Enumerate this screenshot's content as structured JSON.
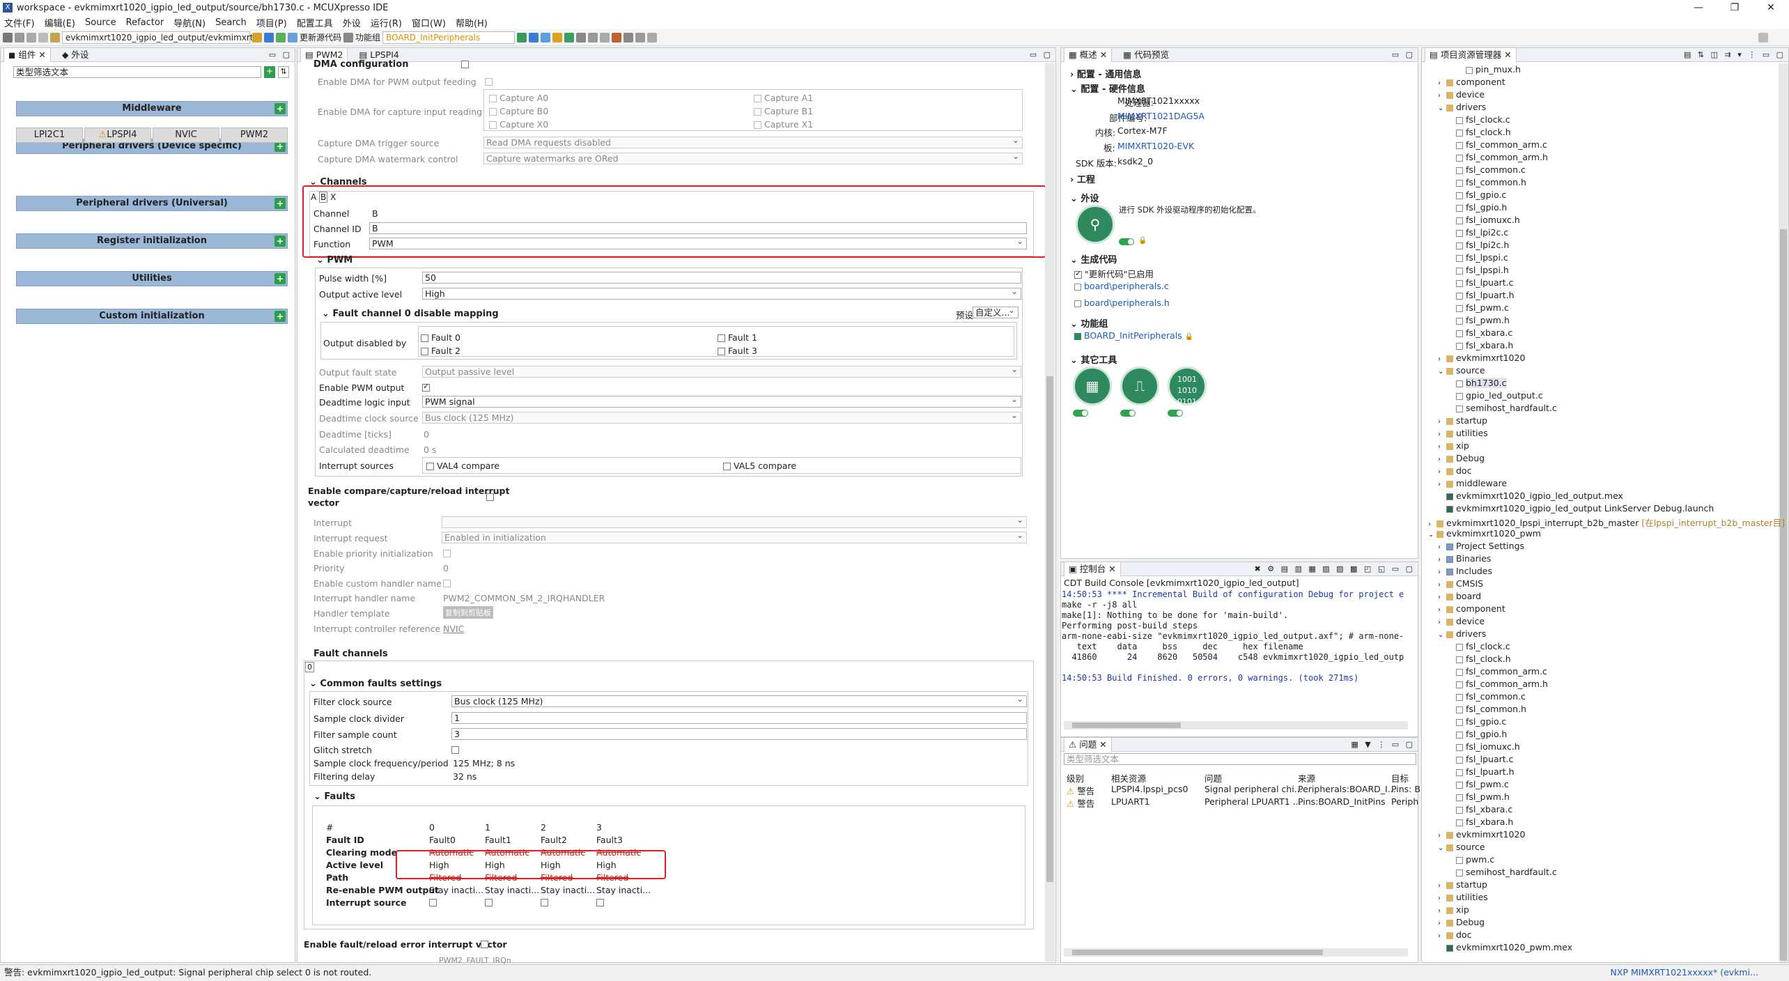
{
  "window": {
    "title": "workspace - evkmimxrt1020_igpio_led_output/source/bh1730.c - MCUXpresso IDE",
    "controls": [
      "—",
      "❐",
      "✕"
    ]
  },
  "menu": [
    "文件(F)",
    "编辑(E)",
    "Source",
    "Refactor",
    "导航(N)",
    "Search",
    "项目(P)",
    "配置工具",
    "外设",
    "运行(R)",
    "窗口(W)",
    "帮助(H)"
  ],
  "toolbar": {
    "project_combo": "evkmimxrt1020_igpio_led_output/evkmimxrt1(",
    "update_code": "更新源代码",
    "func_group_label": "功能组",
    "func_group_value": "BOARD_InitPeripherals"
  },
  "left_panel": {
    "tabs": [
      "组件",
      "外设"
    ],
    "filter_placeholder": "类型筛选文本",
    "middleware": "Middleware",
    "periph_device": "Peripheral drivers (Device specific)",
    "device_buttons": [
      "LPI2C1",
      "LPSPI4",
      "NVIC",
      "PWM2"
    ],
    "periph_universal": "Peripheral drivers (Universal)",
    "register_init": "Register initialization",
    "utilities": "Utilities",
    "custom_init": "Custom initialization"
  },
  "editor": {
    "tabs": [
      "PWM2",
      "LPSPI4"
    ],
    "dma_config": "DMA configuration",
    "dma_pwm_feeding": "Enable DMA for PWM output feeding",
    "dma_capture_reading": "Enable DMA for capture input reading",
    "captures": [
      "Capture A0",
      "Capture A1",
      "Capture B0",
      "Capture B1",
      "Capture X0",
      "Capture X1"
    ],
    "capture_trigger_label": "Capture DMA trigger source",
    "capture_trigger_value": "Read DMA requests disabled",
    "capture_watermark_label": "Capture DMA watermark control",
    "capture_watermark_value": "Capture watermarks are ORed",
    "channels": "Channels",
    "channel_tabs": [
      "A",
      "B",
      "X"
    ],
    "channel_label": "Channel",
    "channel_value": "B",
    "channel_id_label": "Channel ID",
    "channel_id_value": "B",
    "function_label": "Function",
    "function_value": "PWM",
    "pwm_section": "PWM",
    "pulse_width_label": "Pulse width [%]",
    "pulse_width_value": "50",
    "output_active_label": "Output active level",
    "output_active_value": "High",
    "fault_mapping": "Fault channel 0 disable mapping",
    "preset_label": "预设",
    "preset_value": "自定义...",
    "output_disabled_by": "Output disabled by",
    "faults_list": [
      "Fault 0",
      "Fault 1",
      "Fault 2",
      "Fault 3"
    ],
    "output_fault_state_label": "Output fault state",
    "output_fault_state_value": "Output passive level",
    "enable_pwm_output": "Enable PWM output",
    "deadtime_input_label": "Deadtime logic input",
    "deadtime_input_value": "PWM signal",
    "deadtime_clock_label": "Deadtime clock source",
    "deadtime_clock_value": "Bus clock (125 MHz)",
    "deadtime_ticks_label": "Deadtime [ticks]",
    "deadtime_ticks_value": "0",
    "calc_deadtime_label": "Calculated deadtime",
    "calc_deadtime_value": "0 s",
    "interrupt_sources_label": "Interrupt sources",
    "val4": "VAL4 compare",
    "val5": "VAL5 compare",
    "enable_ccr_line1": "Enable compare/capture/reload interrupt",
    "enable_ccr_line2": "vector",
    "interrupt_label": "Interrupt",
    "interrupt_request_label": "Interrupt request",
    "interrupt_request_value": "Enabled in initialization",
    "enable_priority_label": "Enable priority initialization",
    "priority_label": "Priority",
    "priority_value": "0",
    "enable_custom_handler": "Enable custom handler name",
    "handler_name_label": "Interrupt handler name",
    "handler_name_value": "PWM2_COMMON_SM_2_IRQHANDLER",
    "handler_template_label": "Handler template",
    "handler_template_btn": "复制到剪贴板",
    "irq_controller_label": "Interrupt controller reference",
    "irq_controller_value": "NVIC",
    "fault_channels": "Fault channels",
    "fault_channel_tab": "0",
    "common_faults": "Common faults settings",
    "filter_clock_label": "Filter clock source",
    "filter_clock_value": "Bus clock (125 MHz)",
    "sample_divider_label": "Sample clock divider",
    "sample_divider_value": "1",
    "filter_count_label": "Filter sample count",
    "filter_count_value": "3",
    "glitch_label": "Glitch stretch",
    "sample_freq_label": "Sample clock frequency/period",
    "sample_freq_value": "125 MHz; 8 ns",
    "filtering_delay_label": "Filtering delay",
    "filtering_delay_value": "32 ns",
    "faults_section": "Faults",
    "faults_table": {
      "row_labels": [
        "#",
        "Fault ID",
        "Clearing mode",
        "Active level",
        "Path",
        "Re-enable PWM output",
        "Interrupt source"
      ],
      "columns": [
        {
          "num": "0",
          "id": "Fault0",
          "clearing": "Automatic",
          "active": "High",
          "path": "Filtered",
          "reenable": "Stay inacti..."
        },
        {
          "num": "1",
          "id": "Fault1",
          "clearing": "Automatic",
          "active": "High",
          "path": "Filtered",
          "reenable": "Stay inacti..."
        },
        {
          "num": "2",
          "id": "Fault2",
          "clearing": "Automatic",
          "active": "High",
          "path": "Filtered",
          "reenable": "Stay inacti..."
        },
        {
          "num": "3",
          "id": "Fault3",
          "clearing": "Automatic",
          "active": "High",
          "path": "Filtered",
          "reenable": "Stay inacti..."
        }
      ]
    },
    "fault_reload_label": "Enable fault/reload error interrupt vector",
    "bottom_cut_value": "PWM2_FAULT_IRQn"
  },
  "overview": {
    "tabs": [
      "概述",
      "代码预览"
    ],
    "config_common": "配置 - 通用信息",
    "config_hw": "配置 - 硬件信息",
    "processor_label": "处理器:",
    "processor_value": "MIMXRT1021xxxxx",
    "part_label": "部件编号:",
    "part_value": "MIMXRT1021DAG5A",
    "core_label": "内核:",
    "core_value": "Cortex-M7F",
    "board_label": "板:",
    "board_value": "MIMXRT1020-EVK",
    "sdk_label": "SDK 版本:",
    "sdk_value": "ksdk2_0",
    "project": "工程",
    "peripherals": "外设",
    "peripherals_desc": "进行 SDK 外设驱动程序的初始化配置。",
    "gen_code": "生成代码",
    "update_enabled": "\"更新代码\"已启用",
    "file1": "board\\peripherals.c",
    "file2": "board\\peripherals.h",
    "func_group": "功能组",
    "func_group_item": "BOARD_InitPeripherals",
    "other_tools": "其它工具"
  },
  "console": {
    "tab": "控制台",
    "title": "CDT Build Console [evkmimxrt1020_igpio_led_output]",
    "lines": [
      "14:50:53 **** Incremental Build of configuration Debug for project e",
      "make -r -j8 all",
      "make[1]: Nothing to be done for 'main-build'.",
      "Performing post-build steps",
      "arm-none-eabi-size \"evkmimxrt1020_igpio_led_output.axf\"; # arm-none-",
      "   text    data     bss     dec     hex filename",
      "  41860      24    8620   50504    c548 evkmimxrt1020_igpio_led_outp",
      "",
      "14:50:53 Build Finished. 0 errors, 0 warnings. (took 271ms)"
    ]
  },
  "problems": {
    "tab": "问题",
    "filter_placeholder": "类型筛选文本",
    "headers": [
      "级别",
      "相关资源",
      "问题",
      "来源",
      "目标"
    ],
    "rows": [
      {
        "level": "警告",
        "resource": "LPSPI4.lpspi_pcs0",
        "problem": "Signal peripheral chi...",
        "source": "Peripherals:BOARD_I...",
        "target": "Pins: B"
      },
      {
        "level": "警告",
        "resource": "LPUART1",
        "problem": "Peripheral LPUART1 ...",
        "source": "Pins:BOARD_InitPins",
        "target": "Periph"
      }
    ]
  },
  "explorer": {
    "tab": "项目资源管理器",
    "items": [
      {
        "d": 3,
        "t": "pin_mux.h",
        "k": "h"
      },
      {
        "d": 1,
        "t": "component",
        "k": "f"
      },
      {
        "d": 1,
        "t": "device",
        "k": "f"
      },
      {
        "d": 1,
        "t": "drivers",
        "k": "f",
        "open": true
      },
      {
        "d": 2,
        "t": "fsl_clock.c",
        "k": "c"
      },
      {
        "d": 2,
        "t": "fsl_clock.h",
        "k": "h"
      },
      {
        "d": 2,
        "t": "fsl_common_arm.c",
        "k": "c"
      },
      {
        "d": 2,
        "t": "fsl_common_arm.h",
        "k": "h"
      },
      {
        "d": 2,
        "t": "fsl_common.c",
        "k": "c"
      },
      {
        "d": 2,
        "t": "fsl_common.h",
        "k": "h"
      },
      {
        "d": 2,
        "t": "fsl_gpio.c",
        "k": "c"
      },
      {
        "d": 2,
        "t": "fsl_gpio.h",
        "k": "h"
      },
      {
        "d": 2,
        "t": "fsl_iomuxc.h",
        "k": "h"
      },
      {
        "d": 2,
        "t": "fsl_lpi2c.c",
        "k": "c"
      },
      {
        "d": 2,
        "t": "fsl_lpi2c.h",
        "k": "h"
      },
      {
        "d": 2,
        "t": "fsl_lpspi.c",
        "k": "c"
      },
      {
        "d": 2,
        "t": "fsl_lpspi.h",
        "k": "h"
      },
      {
        "d": 2,
        "t": "fsl_lpuart.c",
        "k": "c"
      },
      {
        "d": 2,
        "t": "fsl_lpuart.h",
        "k": "h"
      },
      {
        "d": 2,
        "t": "fsl_pwm.c",
        "k": "c"
      },
      {
        "d": 2,
        "t": "fsl_pwm.h",
        "k": "h"
      },
      {
        "d": 2,
        "t": "fsl_xbara.c",
        "k": "c"
      },
      {
        "d": 2,
        "t": "fsl_xbara.h",
        "k": "h"
      },
      {
        "d": 1,
        "t": "evkmimxrt1020",
        "k": "f"
      },
      {
        "d": 1,
        "t": "source",
        "k": "f",
        "open": true
      },
      {
        "d": 2,
        "t": "bh1730.c",
        "k": "c",
        "sel": true
      },
      {
        "d": 2,
        "t": "gpio_led_output.c",
        "k": "c"
      },
      {
        "d": 2,
        "t": "semihost_hardfault.c",
        "k": "c"
      },
      {
        "d": 1,
        "t": "startup",
        "k": "f"
      },
      {
        "d": 1,
        "t": "utilities",
        "k": "f"
      },
      {
        "d": 1,
        "t": "xip",
        "k": "f"
      },
      {
        "d": 1,
        "t": "Debug",
        "k": "f"
      },
      {
        "d": 1,
        "t": "doc",
        "k": "f"
      },
      {
        "d": 1,
        "t": "middleware",
        "k": "f"
      },
      {
        "d": 1,
        "t": "evkmimxrt1020_igpio_led_output.mex",
        "k": "m"
      },
      {
        "d": 1,
        "t": "evkmimxrt1020_igpio_led_output LinkServer Debug.launch",
        "k": "m"
      },
      {
        "d": 0,
        "t": "evkmimxrt1020_lpspi_interrupt_b2b_master",
        "k": "p",
        "extra": "[在lpspi_interrupt_b2b_master目]"
      },
      {
        "d": 0,
        "t": "evkmimxrt1020_pwm",
        "k": "p",
        "open": true
      },
      {
        "d": 1,
        "t": "Project Settings",
        "k": "s"
      },
      {
        "d": 1,
        "t": "Binaries",
        "k": "s"
      },
      {
        "d": 1,
        "t": "Includes",
        "k": "s"
      },
      {
        "d": 1,
        "t": "CMSIS",
        "k": "f"
      },
      {
        "d": 1,
        "t": "board",
        "k": "f"
      },
      {
        "d": 1,
        "t": "component",
        "k": "f"
      },
      {
        "d": 1,
        "t": "device",
        "k": "f"
      },
      {
        "d": 1,
        "t": "drivers",
        "k": "f",
        "open": true
      },
      {
        "d": 2,
        "t": "fsl_clock.c",
        "k": "c"
      },
      {
        "d": 2,
        "t": "fsl_clock.h",
        "k": "h"
      },
      {
        "d": 2,
        "t": "fsl_common_arm.c",
        "k": "c"
      },
      {
        "d": 2,
        "t": "fsl_common_arm.h",
        "k": "h"
      },
      {
        "d": 2,
        "t": "fsl_common.c",
        "k": "c"
      },
      {
        "d": 2,
        "t": "fsl_common.h",
        "k": "h"
      },
      {
        "d": 2,
        "t": "fsl_gpio.c",
        "k": "c"
      },
      {
        "d": 2,
        "t": "fsl_gpio.h",
        "k": "h"
      },
      {
        "d": 2,
        "t": "fsl_iomuxc.h",
        "k": "h"
      },
      {
        "d": 2,
        "t": "fsl_lpuart.c",
        "k": "c"
      },
      {
        "d": 2,
        "t": "fsl_lpuart.h",
        "k": "h"
      },
      {
        "d": 2,
        "t": "fsl_pwm.c",
        "k": "c"
      },
      {
        "d": 2,
        "t": "fsl_pwm.h",
        "k": "h"
      },
      {
        "d": 2,
        "t": "fsl_xbara.c",
        "k": "c"
      },
      {
        "d": 2,
        "t": "fsl_xbara.h",
        "k": "h"
      },
      {
        "d": 1,
        "t": "evkmimxrt1020",
        "k": "f"
      },
      {
        "d": 1,
        "t": "source",
        "k": "f",
        "open": true
      },
      {
        "d": 2,
        "t": "pwm.c",
        "k": "c"
      },
      {
        "d": 2,
        "t": "semihost_hardfault.c",
        "k": "c"
      },
      {
        "d": 1,
        "t": "startup",
        "k": "f"
      },
      {
        "d": 1,
        "t": "utilities",
        "k": "f"
      },
      {
        "d": 1,
        "t": "xip",
        "k": "f"
      },
      {
        "d": 1,
        "t": "Debug",
        "k": "f"
      },
      {
        "d": 1,
        "t": "doc",
        "k": "f"
      },
      {
        "d": 1,
        "t": "evkmimxrt1020_pwm.mex",
        "k": "m"
      }
    ]
  },
  "status": {
    "message": "警告:  evkmimxrt1020_igpio_led_output: Signal peripheral chip select 0 is not routed.",
    "right": "NXP MIMXRT1021xxxxx* (evkmi..."
  }
}
